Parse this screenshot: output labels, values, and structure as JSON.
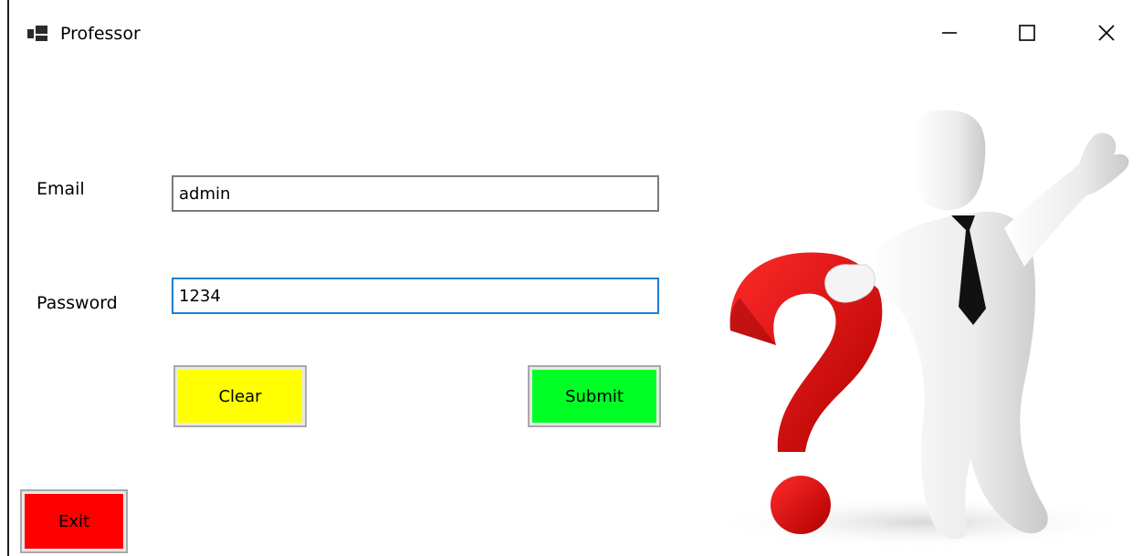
{
  "window": {
    "title": "Professor",
    "icon": "window-app-icon",
    "controls": [
      "minimize-icon",
      "maximize-icon",
      "close-icon"
    ]
  },
  "form": {
    "email_label": "Email",
    "email_value": "admin",
    "password_label": "Password",
    "password_value": "1234",
    "clear_label": "Clear",
    "submit_label": "Submit",
    "exit_label": "Exit"
  },
  "colors": {
    "clear_button": "#ffff00",
    "submit_button": "#00ff24",
    "exit_button": "#ff0000",
    "focus_border": "#1a7fd4"
  },
  "illustration": {
    "icon": "question-mark-person-icon"
  }
}
